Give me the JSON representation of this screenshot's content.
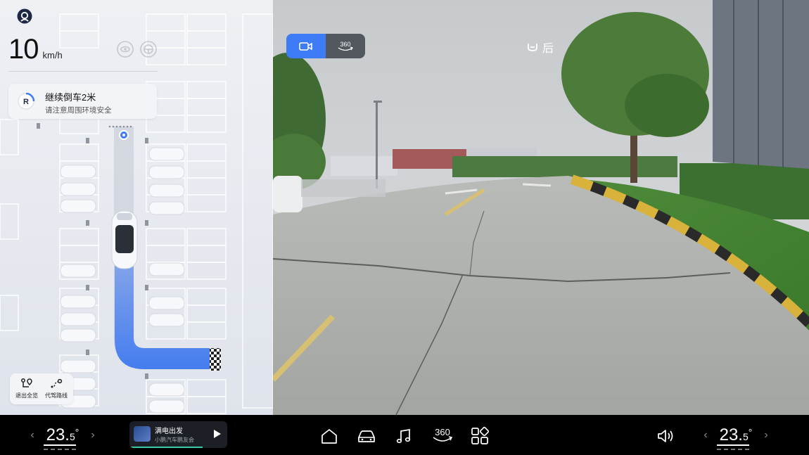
{
  "left_panel": {
    "speed": {
      "value": "10",
      "unit": "km/h"
    },
    "guidance": {
      "gear": "R",
      "title": "继续倒车2米",
      "subtitle": "请注意周围环境安全"
    },
    "controls": {
      "exit_overview": "退出全览",
      "driving_route": "代驾路线"
    }
  },
  "camera": {
    "toggle": {
      "video_icon": "video-camera-icon",
      "surround_label": "360"
    },
    "view_label": "后"
  },
  "dock": {
    "left_temp": {
      "whole": "23.",
      "decimal": "5",
      "degree": "°"
    },
    "right_temp": {
      "whole": "23.",
      "decimal": "5",
      "degree": "°"
    },
    "media": {
      "title": "满电出发",
      "subtitle": "小鹏汽车鹏友会"
    },
    "center_icons": [
      "home-icon",
      "car-icon",
      "music-icon",
      "surround-view-360-icon",
      "apps-icon"
    ],
    "center_360_label": "360"
  },
  "colors": {
    "accent": "#3e7cf7",
    "path_blue": "#3d78f0",
    "map_bg": "#e3e6ee",
    "progress": "#3ec9a6"
  }
}
